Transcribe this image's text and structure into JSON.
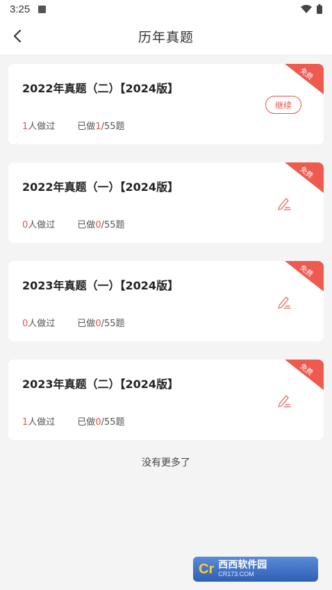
{
  "status_bar": {
    "time": "3:25",
    "icons": [
      "image-icon",
      "wifi-icon",
      "battery-icon"
    ]
  },
  "header": {
    "title": "历年真题",
    "back_icon": "chevron-left-icon"
  },
  "colors": {
    "accent": "#e5524b",
    "background": "#f4f4f4",
    "card": "#ffffff"
  },
  "cards": [
    {
      "title": "2022年真题（二）【2024版】",
      "badge": "免费",
      "people_count": "1",
      "people_suffix": "人做过",
      "done_prefix": "已做",
      "done_count": "1",
      "done_total": "/55题",
      "action": "continue",
      "action_label": "继续"
    },
    {
      "title": "2022年真题（一）【2024版】",
      "badge": "免费",
      "people_count": "0",
      "people_suffix": "人做过",
      "done_prefix": "已做",
      "done_count": "0",
      "done_total": "/55题",
      "action": "edit",
      "action_icon": "edit-icon"
    },
    {
      "title": "2023年真题（一）【2024版】",
      "badge": "免费",
      "people_count": "0",
      "people_suffix": "人做过",
      "done_prefix": "已做",
      "done_count": "0",
      "done_total": "/55题",
      "action": "edit",
      "action_icon": "edit-icon"
    },
    {
      "title": "2023年真题（二）【2024版】",
      "badge": "免费",
      "people_count": "1",
      "people_suffix": "人做过",
      "done_prefix": "已做",
      "done_count": "0",
      "done_total": "/55题",
      "action": "edit",
      "action_icon": "edit-icon"
    }
  ],
  "footer": {
    "no_more": "没有更多了"
  },
  "watermark": {
    "name": "西西软件园",
    "url": "CR173.COM"
  }
}
